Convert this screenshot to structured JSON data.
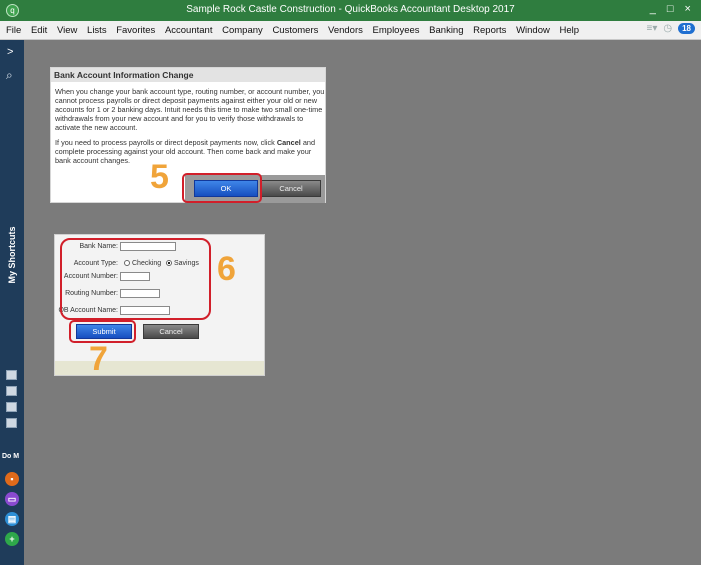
{
  "window": {
    "title": "Sample Rock Castle Construction  - QuickBooks Accountant Desktop 2017",
    "controls": "_ □ ×"
  },
  "menu": {
    "items": [
      "File",
      "Edit",
      "View",
      "Lists",
      "Favorites",
      "Accountant",
      "Company",
      "Customers",
      "Vendors",
      "Employees",
      "Banking",
      "Reports",
      "Window",
      "Help"
    ],
    "badge": "18"
  },
  "leftnav": {
    "expand": ">",
    "shortcuts_label": "My Shortcuts",
    "do_label": "Do M"
  },
  "dialog1": {
    "title": "Bank Account Information Change",
    "para1": "When you change your bank account type, routing number, or account number, you cannot process payrolls or direct deposit payments against either your old or new accounts for 1 or 2 banking days. Intuit needs this time to make two small one-time withdrawals from your new account and for you to verify those withdrawals to activate the new account.",
    "para2_pre": "If you need to process payrolls or direct deposit payments now, click ",
    "para2_bold": "Cancel",
    "para2_post": " and complete processing against your old account. Then come back and make your bank account changes.",
    "ok_label": "OK",
    "cancel_label": "Cancel",
    "step_number": "5"
  },
  "dialog2": {
    "bank_name_label": "Bank Name:",
    "account_type_label": "Account Type:",
    "checking_label": "Checking",
    "savings_label": "Savings",
    "account_number_label": "Account Number:",
    "routing_number_label": "Routing Number:",
    "qb_account_name_label": "QB Account Name:",
    "submit_label": "Submit",
    "cancel_label": "Cancel",
    "step6": "6",
    "step7": "7"
  },
  "colors": {
    "titlebar": "#2f7d3f",
    "nav": "#1f3c5a",
    "workspace": "#7b7b7b",
    "highlight": "#d11f2a",
    "step_orange": "#f0a43a"
  }
}
